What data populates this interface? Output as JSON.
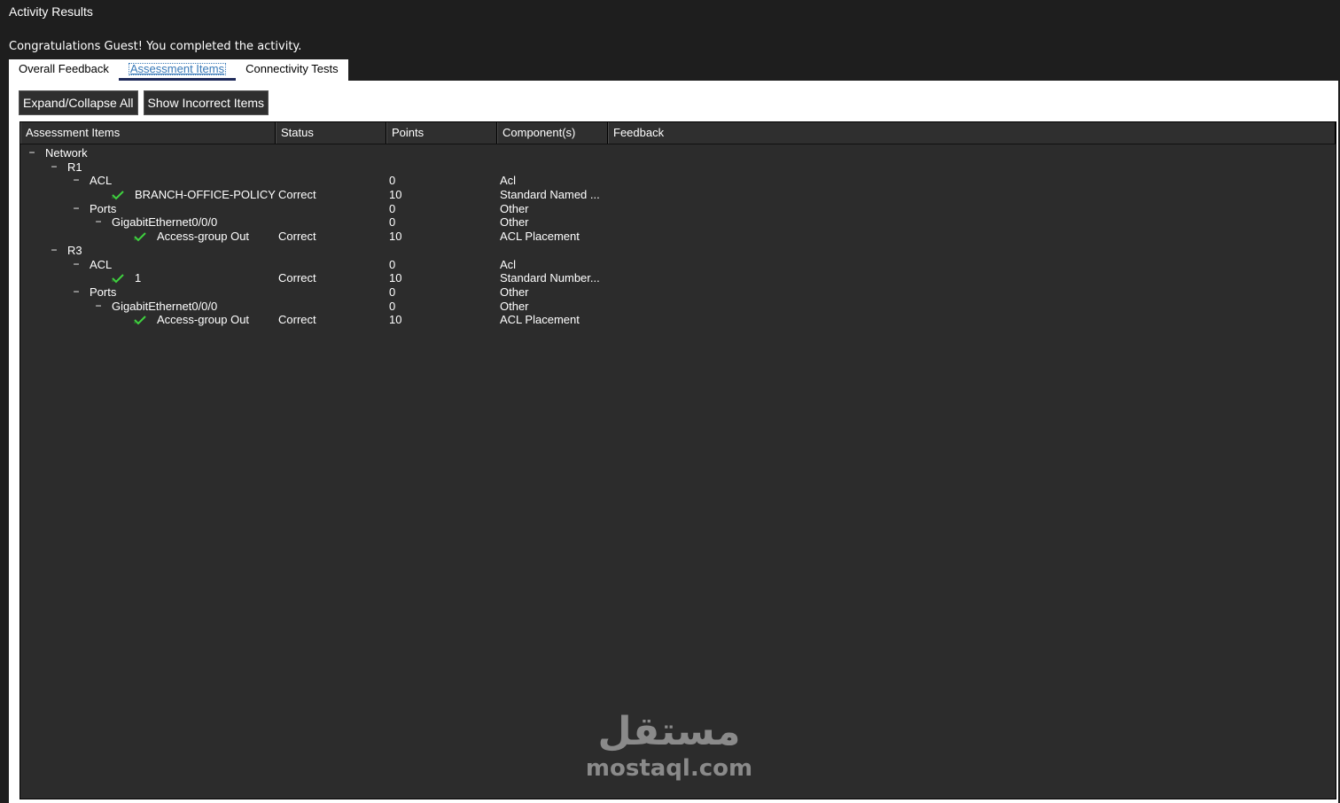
{
  "window": {
    "title": "Activity Results"
  },
  "message": "Congratulations Guest! You completed the activity.",
  "tabs": [
    {
      "label": "Overall Feedback",
      "active": false
    },
    {
      "label": "Assessment Items",
      "active": true
    },
    {
      "label": "Connectivity Tests",
      "active": false
    }
  ],
  "toolbar": {
    "expand_label": "Expand/Collapse All",
    "incorrect_label": "Show Incorrect Items"
  },
  "columns": [
    "Assessment Items",
    "Status",
    "Points",
    "Component(s)",
    "Feedback"
  ],
  "rows": [
    {
      "name": "Network",
      "status": "",
      "points": "",
      "component": "",
      "expander": "−",
      "check": false
    },
    {
      "name": "R1",
      "status": "",
      "points": "",
      "component": "",
      "expander": "−",
      "check": false
    },
    {
      "name": "ACL",
      "status": "",
      "points": "0",
      "component": "Acl",
      "expander": "−",
      "check": false
    },
    {
      "name": "BRANCH-OFFICE-POLICY",
      "status": "Correct",
      "points": "10",
      "component": "Standard Named ...",
      "expander": "",
      "check": true
    },
    {
      "name": "Ports",
      "status": "",
      "points": "0",
      "component": "Other",
      "expander": "−",
      "check": false
    },
    {
      "name": "GigabitEthernet0/0/0",
      "status": "",
      "points": "0",
      "component": "Other",
      "expander": "−",
      "check": false
    },
    {
      "name": "Access-group Out",
      "status": "Correct",
      "points": "10",
      "component": "ACL Placement",
      "expander": "",
      "check": true
    },
    {
      "name": "R3",
      "status": "",
      "points": "",
      "component": "",
      "expander": "−",
      "check": false
    },
    {
      "name": "ACL",
      "status": "",
      "points": "0",
      "component": "Acl",
      "expander": "−",
      "check": false
    },
    {
      "name": "1",
      "status": "Correct",
      "points": "10",
      "component": "Standard Number...",
      "expander": "",
      "check": true
    },
    {
      "name": "Ports",
      "status": "",
      "points": "0",
      "component": "Other",
      "expander": "−",
      "check": false
    },
    {
      "name": "GigabitEthernet0/0/0",
      "status": "",
      "points": "0",
      "component": "Other",
      "expander": "−",
      "check": false
    },
    {
      "name": "Access-group Out",
      "status": "Correct",
      "points": "10",
      "component": "ACL Placement",
      "expander": "",
      "check": true
    }
  ],
  "watermark": {
    "arabic": "مستقل",
    "latin": "mostaql.com"
  },
  "colors": {
    "check": "#3fd23f",
    "active_tab_underline": "#1f2a5a",
    "tree_bg": "#2c2c2c"
  }
}
